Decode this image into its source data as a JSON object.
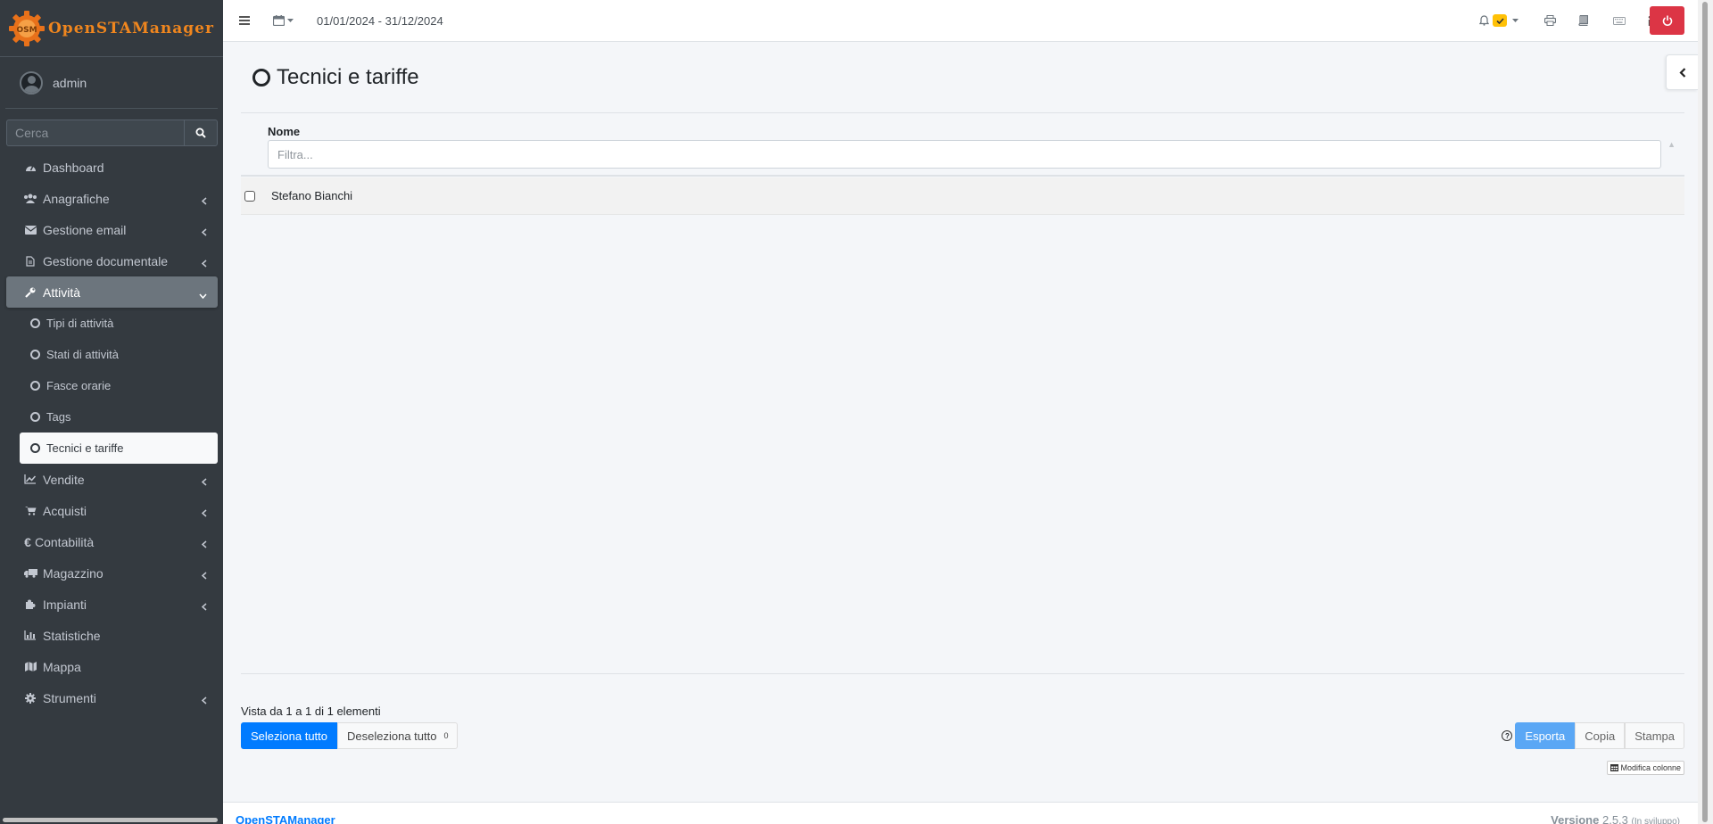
{
  "app": {
    "brand": "OpenSTAManager",
    "user": "admin",
    "date_range": "01/01/2024 - 31/12/2024"
  },
  "sidebar": {
    "search_placeholder": "Cerca",
    "items": [
      {
        "label": "Dashboard",
        "icon": "dashboard-icon",
        "expandable": false
      },
      {
        "label": "Anagrafiche",
        "icon": "users-icon",
        "expandable": true
      },
      {
        "label": "Gestione email",
        "icon": "envelope-icon",
        "expandable": true
      },
      {
        "label": "Gestione documentale",
        "icon": "file-icon",
        "expandable": true
      },
      {
        "label": "Attività",
        "icon": "wrench-icon",
        "expandable": true,
        "active": true
      },
      {
        "label": "Vendite",
        "icon": "chart-line-icon",
        "expandable": true
      },
      {
        "label": "Acquisti",
        "icon": "cart-icon",
        "expandable": true
      },
      {
        "label": "Contabilità",
        "icon": "euro-icon",
        "expandable": true
      },
      {
        "label": "Magazzino",
        "icon": "truck-icon",
        "expandable": true
      },
      {
        "label": "Impianti",
        "icon": "puzzle-icon",
        "expandable": true
      },
      {
        "label": "Statistiche",
        "icon": "bar-chart-icon",
        "expandable": false
      },
      {
        "label": "Mappa",
        "icon": "map-icon",
        "expandable": false
      },
      {
        "label": "Strumenti",
        "icon": "cog-icon",
        "expandable": true
      }
    ],
    "subitems": [
      {
        "label": "Tipi di attività"
      },
      {
        "label": "Stati di attività"
      },
      {
        "label": "Fasce orarie"
      },
      {
        "label": "Tags"
      },
      {
        "label": "Tecnici e tariffe",
        "active": true
      }
    ]
  },
  "page": {
    "title": "Tecnici e tariffe",
    "column_header": "Nome",
    "filter_placeholder": "Filtra...",
    "rows": [
      {
        "name": "Stefano Bianchi"
      }
    ],
    "info": "Vista da 1 a 1 di 1 elementi",
    "select_all": "Seleziona tutto",
    "deselect_all": "Deseleziona tutto",
    "selected_count": "0",
    "export": "Esporta",
    "copy": "Copia",
    "print": "Stampa",
    "modify_columns": "Modifica colonne"
  },
  "footer": {
    "left": "OpenSTAManager",
    "version_label": "Versione",
    "version": "2.5.3",
    "version_note": "(In sviluppo)"
  },
  "colors": {
    "sidebar_bg": "#343a40",
    "primary": "#007bff",
    "danger": "#dc3545",
    "brand_orange": "#f0861e",
    "warning": "#ffc107"
  }
}
